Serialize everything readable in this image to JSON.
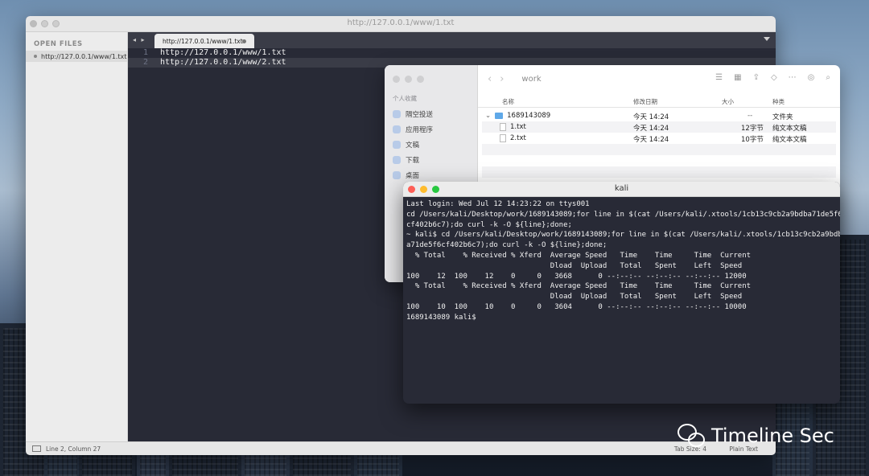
{
  "editor": {
    "window_title": "http://127.0.0.1/www/1.txt",
    "sidebar_header": "OPEN FILES",
    "open_file": "http://127.0.0.1/www/1.txt",
    "tab_nav": "◂ ▸",
    "tab_label": "http://127.0.0.1/www/1.txt",
    "lines": [
      {
        "num": "1",
        "text": "http://127.0.0.1/www/1.txt"
      },
      {
        "num": "2",
        "text": "http://127.0.0.1/www/2.txt"
      }
    ],
    "status": {
      "position": "Line 2, Column 27",
      "tab_size": "Tab Size: 4",
      "syntax": "Plain Text"
    }
  },
  "finder": {
    "title": "work",
    "sidebar_header": "个人收藏",
    "favorites": [
      "隔空投送",
      "应用程序",
      "文稿",
      "下载",
      "桌面"
    ],
    "columns": {
      "name": "名称",
      "modified": "修改日期",
      "size": "大小",
      "kind": "种类"
    },
    "rows": [
      {
        "name": "1689143089",
        "modified": "今天 14:24",
        "size": "--",
        "kind": "文件夹"
      },
      {
        "name": "1.txt",
        "modified": "今天 14:24",
        "size": "12字节",
        "kind": "纯文本文稿"
      },
      {
        "name": "2.txt",
        "modified": "今天 14:24",
        "size": "10字节",
        "kind": "纯文本文稿"
      }
    ]
  },
  "terminal": {
    "title": "kali",
    "lines": [
      "Last login: Wed Jul 12 14:23:22 on ttys001",
      "cd /Users/kali/Desktop/work/1689143089;for line in $(cat /Users/kali/.xtools/1cb13c9cb2a9bdba71de5f6",
      "cf402b6c7);do curl -k -O ${line};done;",
      "~ kali$ cd /Users/kali/Desktop/work/1689143089;for line in $(cat /Users/kali/.xtools/1cb13c9cb2a9bdb",
      "a71de5f6cf402b6c7);do curl -k -O ${line};done;",
      "  % Total    % Received % Xferd  Average Speed   Time    Time     Time  Current",
      "                                 Dload  Upload   Total   Spent    Left  Speed",
      "100    12  100    12    0     0   3668      0 --:--:-- --:--:-- --:--:-- 12000",
      "  % Total    % Received % Xferd  Average Speed   Time    Time     Time  Current",
      "                                 Dload  Upload   Total   Spent    Left  Speed",
      "100    10  100    10    0     0   3604      0 --:--:-- --:--:-- --:--:-- 10000",
      "1689143089 kali$ "
    ]
  },
  "watermark": "Timeline Sec"
}
